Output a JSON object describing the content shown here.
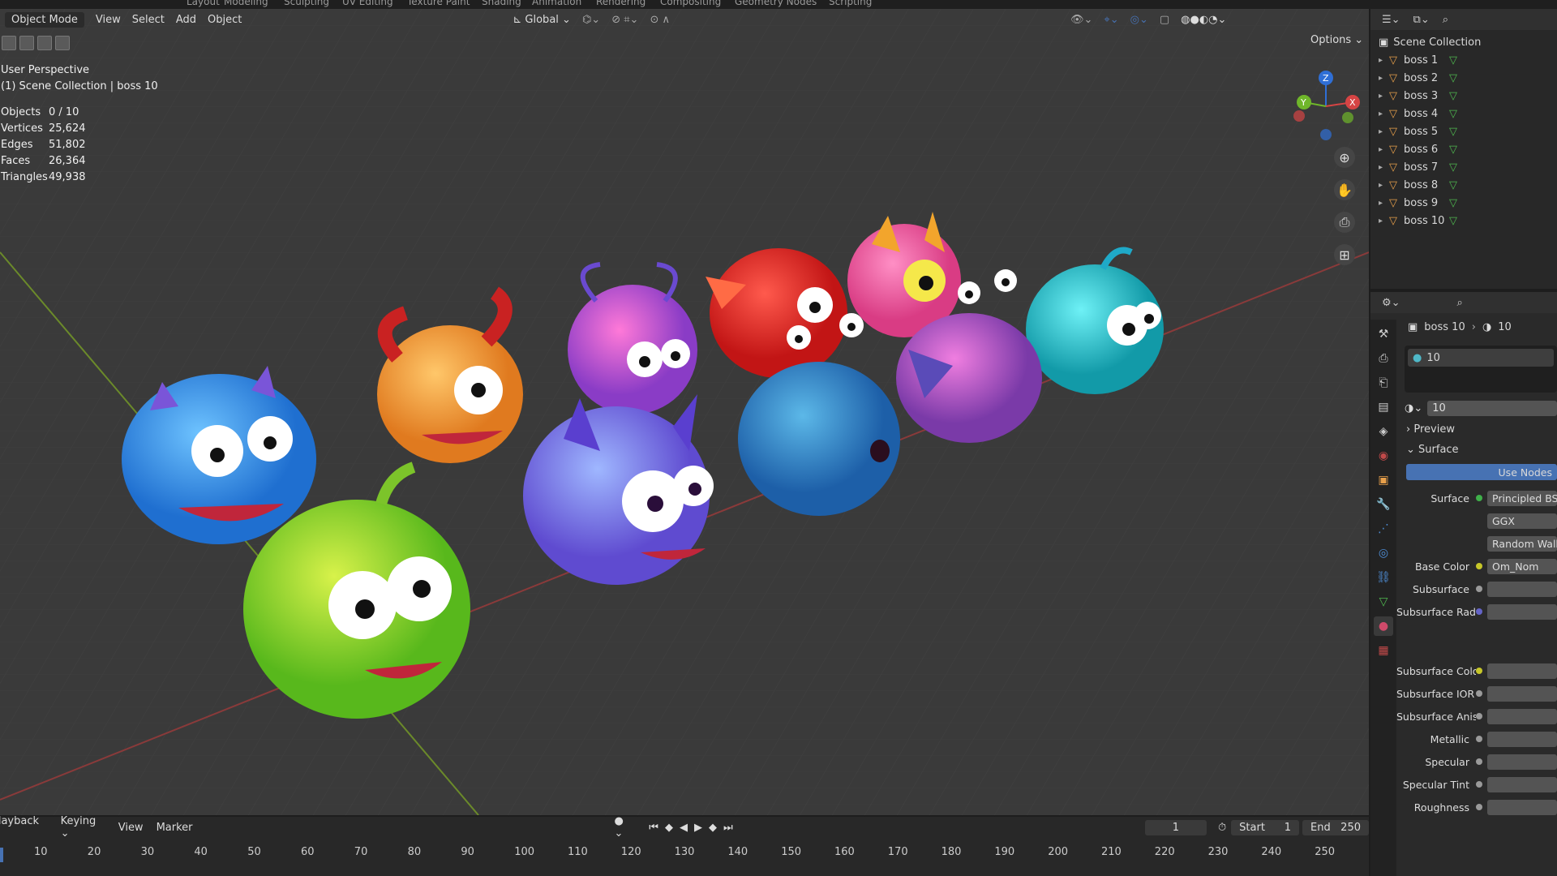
{
  "workspace_tabs": [
    "Layout",
    "Modeling",
    "Sculpting",
    "UV Editing",
    "Texture Paint",
    "Shading",
    "Animation",
    "Rendering",
    "Compositing",
    "Geometry Nodes",
    "Scripting"
  ],
  "viewport": {
    "mode": "Object Mode",
    "menus": [
      "View",
      "Select",
      "Add",
      "Object"
    ],
    "transform_orientation": "Global",
    "options_label": "Options",
    "perspective": "User Perspective",
    "collection_info": "(1) Scene Collection | boss 10",
    "stats": [
      {
        "label": "Objects",
        "value": "0 / 10"
      },
      {
        "label": "Vertices",
        "value": "25,624"
      },
      {
        "label": "Edges",
        "value": "51,802"
      },
      {
        "label": "Faces",
        "value": "26,364"
      },
      {
        "label": "Triangles",
        "value": "49,938"
      }
    ],
    "gizmo": {
      "x": "X",
      "y": "Y",
      "z": "Z"
    }
  },
  "outliner": {
    "root": "Scene Collection",
    "items": [
      "boss 1",
      "boss 2",
      "boss 3",
      "boss 4",
      "boss 5",
      "boss 6",
      "boss 7",
      "boss 8",
      "boss 9",
      "boss 10"
    ]
  },
  "properties": {
    "breadcrumb_object": "boss 10",
    "breadcrumb_material": "10",
    "slot_material": "10",
    "material_name": "10",
    "preview_label": "Preview",
    "surface_label": "Surface",
    "use_nodes_label": "Use Nodes",
    "rows": [
      {
        "label": "Surface",
        "value": "Principled BSDF",
        "dot": "#3fb04a"
      },
      {
        "label": "",
        "value": "GGX",
        "dot": ""
      },
      {
        "label": "",
        "value": "Random Walk",
        "dot": ""
      },
      {
        "label": "Base Color",
        "value": "Om_Nom",
        "dot": "#c7c729"
      },
      {
        "label": "Subsurface",
        "value": "",
        "dot": "#9a9a9a"
      },
      {
        "label": "Subsurface Radius",
        "value": "",
        "dot": "#6464c8"
      },
      {
        "label": "Subsurface Color",
        "value": "",
        "dot": "#c7c729"
      },
      {
        "label": "Subsurface IOR",
        "value": "",
        "dot": "#9a9a9a"
      },
      {
        "label": "Subsurface Aniso...",
        "value": "",
        "dot": "#9a9a9a"
      },
      {
        "label": "Metallic",
        "value": "",
        "dot": "#9a9a9a"
      },
      {
        "label": "Specular",
        "value": "",
        "dot": "#9a9a9a"
      },
      {
        "label": "Specular Tint",
        "value": "",
        "dot": "#9a9a9a"
      },
      {
        "label": "Roughness",
        "value": "",
        "dot": "#9a9a9a"
      }
    ]
  },
  "timeline": {
    "menus": [
      "Playback",
      "Keying",
      "View",
      "Marker"
    ],
    "current_frame": "1",
    "start_label": "Start",
    "start_value": "1",
    "end_label": "End",
    "end_value": "250",
    "ruler": [
      "10",
      "20",
      "30",
      "40",
      "50",
      "60",
      "70",
      "80",
      "90",
      "100",
      "110",
      "120",
      "130",
      "140",
      "150",
      "160",
      "170",
      "180",
      "190",
      "200",
      "210",
      "220",
      "230",
      "240",
      "250"
    ]
  },
  "colors": {
    "accent": "#4772b3",
    "orange": "#e8a04b",
    "green_mesh": "#4fb84f"
  }
}
